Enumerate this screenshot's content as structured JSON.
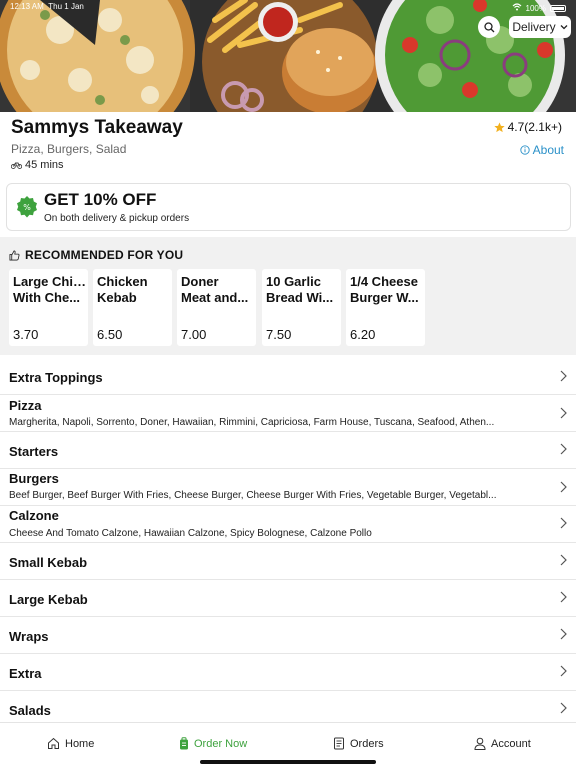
{
  "status_bar": {
    "time": "12:13 AM",
    "date": "Thu 1 Jan",
    "battery": "100%"
  },
  "header": {
    "delivery_label": "Delivery",
    "restaurant_name": "Sammys Takeaway",
    "rating": "4.7(2.1k+)",
    "cuisines": "Pizza, Burgers, Salad",
    "about_label": "About",
    "delivery_time": "45 mins"
  },
  "promo": {
    "title": "GET 10% OFF",
    "subtitle": "On both delivery & pickup orders"
  },
  "recommended": {
    "heading": "RECOMMENDED FOR YOU",
    "items": [
      {
        "line1": "Large Chips",
        "line2": "With Che...",
        "price": "3.70"
      },
      {
        "line1": "Chicken",
        "line2": "Kebab",
        "price": "6.50"
      },
      {
        "line1": "Doner",
        "line2": "Meat and...",
        "price": "7.00"
      },
      {
        "line1": "10 Garlic",
        "line2": "Bread Wi...",
        "price": "7.50"
      },
      {
        "line1": "1/4 Cheese",
        "line2": "Burger W...",
        "price": "6.20"
      }
    ]
  },
  "categories": [
    {
      "title": "Extra Toppings",
      "desc": ""
    },
    {
      "title": "Pizza",
      "desc": "Margherita, Napoli, Sorrento, Doner, Hawaiian, Rimmini, Capriciosa, Farm House, Tuscana, Seafood, Athen..."
    },
    {
      "title": "Starters",
      "desc": ""
    },
    {
      "title": "Burgers",
      "desc": "Beef Burger, Beef Burger With Fries, Cheese Burger, Cheese Burger With Fries, Vegetable Burger, Vegetabl..."
    },
    {
      "title": "Calzone",
      "desc": "Cheese And Tomato Calzone, Hawaiian Calzone, Spicy Bolognese, Calzone Pollo"
    },
    {
      "title": "Small Kebab",
      "desc": ""
    },
    {
      "title": "Large Kebab",
      "desc": ""
    },
    {
      "title": "Wraps",
      "desc": ""
    },
    {
      "title": "Extra",
      "desc": ""
    },
    {
      "title": "Salads",
      "desc": ""
    }
  ],
  "tabs": {
    "home": "Home",
    "order_now": "Order Now",
    "orders": "Orders",
    "account": "Account"
  },
  "colors": {
    "accent_green": "#3ea23e",
    "link_blue": "#2a90c8",
    "star": "#f2b01e"
  }
}
